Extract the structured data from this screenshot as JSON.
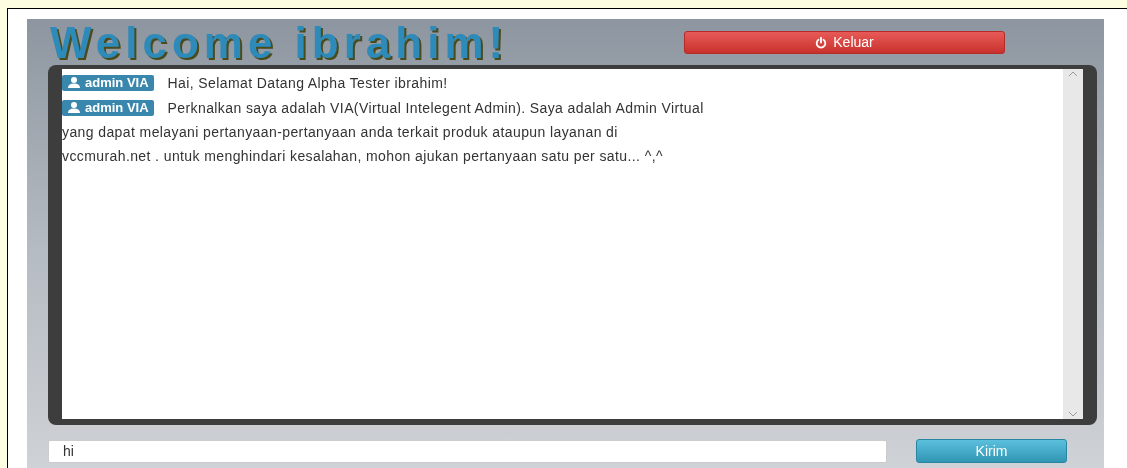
{
  "header": {
    "title": "Welcome ibrahim!",
    "logout_button": "Keluar"
  },
  "messages": [
    {
      "sender": "admin VIA",
      "lines": [
        "Hai, Selamat Datang Alpha Tester ibrahim!"
      ]
    },
    {
      "sender": "admin VIA",
      "lines": [
        "Perknalkan saya adalah VIA(Virtual Intelegent Admin). Saya adalah Admin Virtual",
        "yang dapat melayani pertanyaan-pertanyaan anda terkait produk ataupun layanan di",
        "vccmurah.net . untuk menghindari kesalahan, mohon ajukan pertanyaan satu per satu... ^,^"
      ]
    }
  ],
  "composer": {
    "value": "hi",
    "send_button": "Kirim"
  }
}
